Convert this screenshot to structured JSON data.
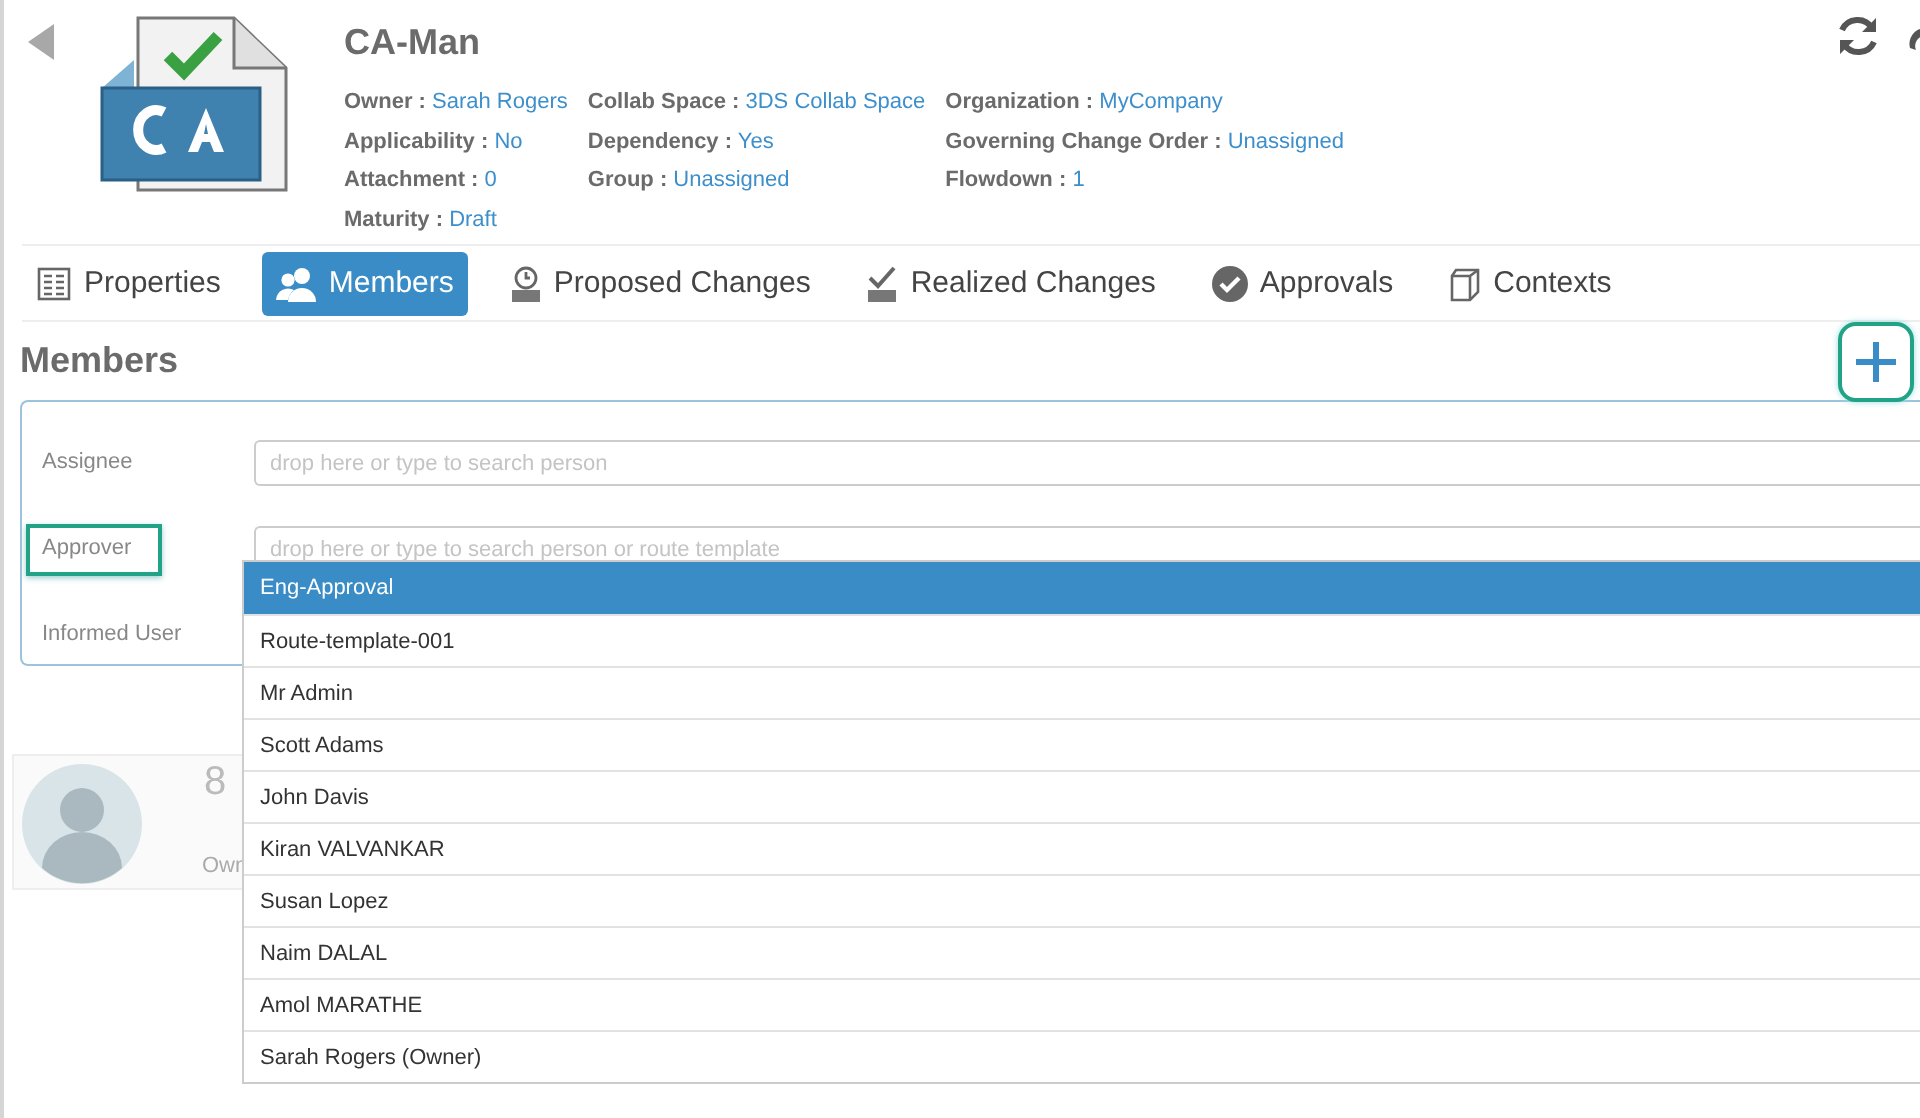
{
  "header": {
    "title": "CA-Man",
    "property_columns": [
      [
        {
          "label": "Owner :",
          "value": "Sarah Rogers"
        },
        {
          "label": "Applicability :",
          "value": "No"
        },
        {
          "label": "Attachment :",
          "value": "0"
        },
        {
          "label": "Maturity :",
          "value": "Draft"
        }
      ],
      [
        {
          "label": "Collab Space :",
          "value": "3DS Collab Space"
        },
        {
          "label": "Dependency :",
          "value": "Yes"
        },
        {
          "label": "Group :",
          "value": "Unassigned"
        }
      ],
      [
        {
          "label": "Organization :",
          "value": "MyCompany"
        },
        {
          "label": "Governing Change Order :",
          "value": "Unassigned"
        },
        {
          "label": "Flowdown :",
          "value": "1"
        }
      ]
    ]
  },
  "tabs": [
    {
      "label": "Properties",
      "selected": false
    },
    {
      "label": "Members",
      "selected": true
    },
    {
      "label": "Proposed Changes",
      "selected": false
    },
    {
      "label": "Realized Changes",
      "selected": false
    },
    {
      "label": "Approvals",
      "selected": false
    },
    {
      "label": "Contexts",
      "selected": false
    }
  ],
  "members": {
    "heading": "Members",
    "fields": [
      {
        "label": "Assignee",
        "placeholder": "drop here or type to search person",
        "highlighted": false
      },
      {
        "label": "Approver",
        "placeholder": "drop here or type to search person or route template",
        "highlighted": true
      },
      {
        "label": "Informed User",
        "highlighted": false
      }
    ],
    "dropdown": [
      {
        "label": "Eng-Approval",
        "selected": true
      },
      {
        "label": "Route-template-001",
        "selected": false
      },
      {
        "label": "Mr Admin",
        "selected": false
      },
      {
        "label": "Scott Adams",
        "selected": false
      },
      {
        "label": "John Davis",
        "selected": false
      },
      {
        "label": "Kiran VALVANKAR",
        "selected": false
      },
      {
        "label": "Susan Lopez",
        "selected": false
      },
      {
        "label": "Naim DALAL",
        "selected": false
      },
      {
        "label": "Amol MARATHE",
        "selected": false
      },
      {
        "label": "Sarah Rogers (Owner)",
        "selected": false
      }
    ],
    "member_card": {
      "count": "8",
      "role": "Own"
    }
  }
}
